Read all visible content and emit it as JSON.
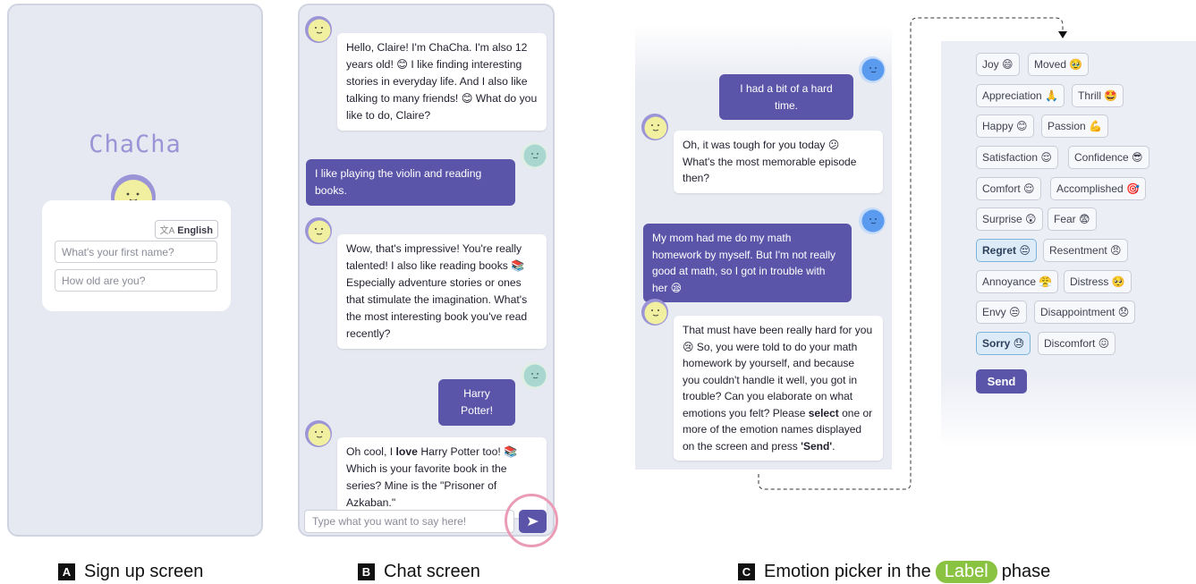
{
  "signup": {
    "logo": "ChaCha",
    "language_button": "English",
    "language_glyph": "文A",
    "name_placeholder": "What's your first name?",
    "age_placeholder": "How old are you?"
  },
  "chat": {
    "messages": [
      {
        "role": "bot",
        "text": "Hello, Claire! I'm ChaCha. I'm also 12 years old! 😊 I like finding interesting stories in everyday life. And I also like talking to many friends! 😊 What do you like to do, Claire?"
      },
      {
        "role": "user",
        "text": "I like playing the violin and reading books."
      },
      {
        "role": "bot",
        "text": "Wow, that's impressive! You're really talented! I also like reading books 📚 Especially adventure stories or ones that stimulate the imagination. What's the most interesting book you've read recently?"
      },
      {
        "role": "user",
        "text": "Harry Potter!"
      },
      {
        "role": "bot",
        "text_before": "Oh cool, I ",
        "text_bold": "love",
        "text_after": " Harry Potter too! 📚 Which is your favorite book in the series? Mine is the \"Prisoner of Azkaban.\""
      }
    ],
    "input_placeholder": "Type what you want to say here!"
  },
  "emotion_chat": {
    "messages": [
      {
        "role": "user",
        "text": "I had a bit of a hard time."
      },
      {
        "role": "bot",
        "text": "Oh, it was tough for you today 😕 What's the most memorable episode then?"
      },
      {
        "role": "user",
        "text": "My mom had me do my math homework by myself. But I'm not really good at math, so I got in trouble with her 😪"
      },
      {
        "role": "bot",
        "text_1": "That must have been really hard for you 😢 So, you were told to do your math homework by yourself, and because you couldn't handle it well, you got in trouble? Can you elaborate on what emotions you felt? Please ",
        "bold_1": "select",
        "text_2": " one or more of the emotion names displayed on the screen and press ",
        "bold_2": "'Send'",
        "text_3": "."
      }
    ]
  },
  "picker": {
    "emotions": [
      {
        "label": "Joy 😄",
        "selected": false
      },
      {
        "label": "Moved 🥹",
        "selected": false
      },
      {
        "label": "Appreciation 🙏",
        "selected": false
      },
      {
        "label": "Thrill 🤩",
        "selected": false
      },
      {
        "label": "Happy 😊",
        "selected": false
      },
      {
        "label": "Passion 💪",
        "selected": false
      },
      {
        "label": "Satisfaction 😌",
        "selected": false
      },
      {
        "label": "Confidence 😎",
        "selected": false
      },
      {
        "label": "Comfort 😌",
        "selected": false
      },
      {
        "label": "Accomplished 🎯",
        "selected": false
      },
      {
        "label": "Surprise 😲",
        "selected": false
      },
      {
        "label": "Fear 😨",
        "selected": false
      },
      {
        "label": "Regret 😔",
        "selected": true
      },
      {
        "label": "Resentment 😠",
        "selected": false
      },
      {
        "label": "Annoyance 😤",
        "selected": false
      },
      {
        "label": "Distress 🥺",
        "selected": false
      },
      {
        "label": "Envy 😒",
        "selected": false
      },
      {
        "label": "Disappointment 😞",
        "selected": false
      },
      {
        "label": "Sorry 😓",
        "selected": true
      },
      {
        "label": "Discomfort 😖",
        "selected": false
      }
    ],
    "send_label": "Send"
  },
  "captions": {
    "a_letter": "A",
    "a_text": "Sign up screen",
    "b_letter": "B",
    "b_text": "Chat screen",
    "c_letter": "C",
    "c_text_before": "Emotion picker in the",
    "c_pill": "Label",
    "c_text_after": "phase"
  },
  "colors": {
    "accent": "#5a55a8",
    "panel_bg": "#e6e9f1",
    "bot_avatar": "#f1efa0",
    "bot_avatar_ring": "#9b94d6",
    "user_avatar_teal": "#a9d7d0",
    "user_avatar_blue": "#5b9bef",
    "selected_chip": "#dcebf7",
    "label_pill": "#8ac342",
    "highlight_ring": "#ea9bb6"
  }
}
